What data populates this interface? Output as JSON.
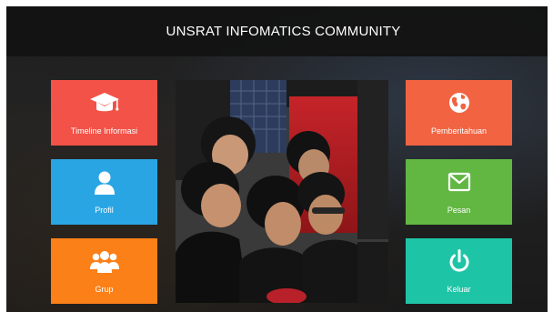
{
  "header": {
    "title": "UNSRAT INFOMATICS COMMUNITY"
  },
  "tiles": [
    {
      "label": "Timeline Informasi",
      "icon": "graduation-cap-icon",
      "color": "#f25247"
    },
    {
      "label": "Profil",
      "icon": "user-icon",
      "color": "#29a5e3"
    },
    {
      "label": "Grup",
      "icon": "group-icon",
      "color": "#fb8018"
    },
    {
      "label": "Pemberitahuan",
      "icon": "globe-icon",
      "color": "#f26341"
    },
    {
      "label": "Pesan",
      "icon": "envelope-icon",
      "color": "#61b742"
    },
    {
      "label": "Keluar",
      "icon": "power-icon",
      "color": "#1ec4a6"
    }
  ],
  "theme": {
    "header_bg": "#121212",
    "page_bg": "#141414"
  }
}
